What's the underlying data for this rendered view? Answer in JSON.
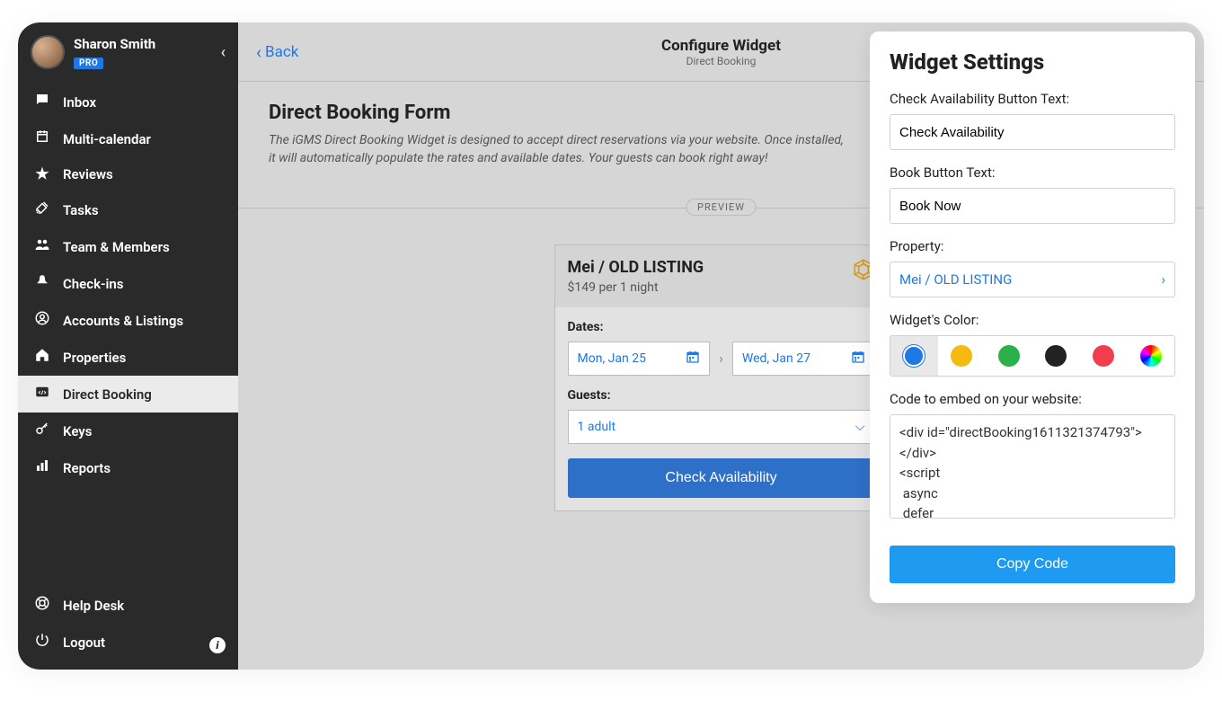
{
  "user": {
    "name": "Sharon Smith",
    "badge": "PRO"
  },
  "sidebar": {
    "items": [
      {
        "label": "Inbox"
      },
      {
        "label": "Multi-calendar"
      },
      {
        "label": "Reviews"
      },
      {
        "label": "Tasks"
      },
      {
        "label": "Team & Members"
      },
      {
        "label": "Check-ins"
      },
      {
        "label": "Accounts & Listings"
      },
      {
        "label": "Properties"
      },
      {
        "label": "Direct Booking"
      },
      {
        "label": "Keys"
      },
      {
        "label": "Reports"
      }
    ],
    "bottom": [
      {
        "label": "Help Desk"
      },
      {
        "label": "Logout"
      }
    ]
  },
  "topbar": {
    "back": "Back",
    "title": "Configure Widget",
    "subtitle": "Direct Booking"
  },
  "page": {
    "title": "Direct Booking Form",
    "description": "The iGMS Direct Booking Widget is designed to accept direct reservations via your website. Once installed, it will automatically populate the rates and available dates. Your guests can book right away!",
    "preview_label": "PREVIEW"
  },
  "widget": {
    "listing": "Mei / OLD LISTING",
    "price": "$149 per 1 night",
    "dates_label": "Dates:",
    "date_from": "Mon, Jan 25",
    "date_to": "Wed, Jan 27",
    "guests_label": "Guests:",
    "guests_value": "1 adult",
    "check_button": "Check Availability"
  },
  "settings": {
    "title": "Widget Settings",
    "avail_label": "Check Availability Button Text:",
    "avail_value": "Check Availability",
    "book_label": "Book Button Text:",
    "book_value": "Book Now",
    "property_label": "Property:",
    "property_value": "Mei / OLD LISTING",
    "color_label": "Widget's Color:",
    "colors": [
      "#1e78e6",
      "#f5b90f",
      "#2bb04a",
      "#222222",
      "#f03e4d",
      "rainbow"
    ],
    "code_label": "Code to embed on your website:",
    "code_value": "<div id=\"directBooking1611321374793\">\n</div>\n<script\n async\n defer",
    "copy_button": "Copy Code"
  }
}
